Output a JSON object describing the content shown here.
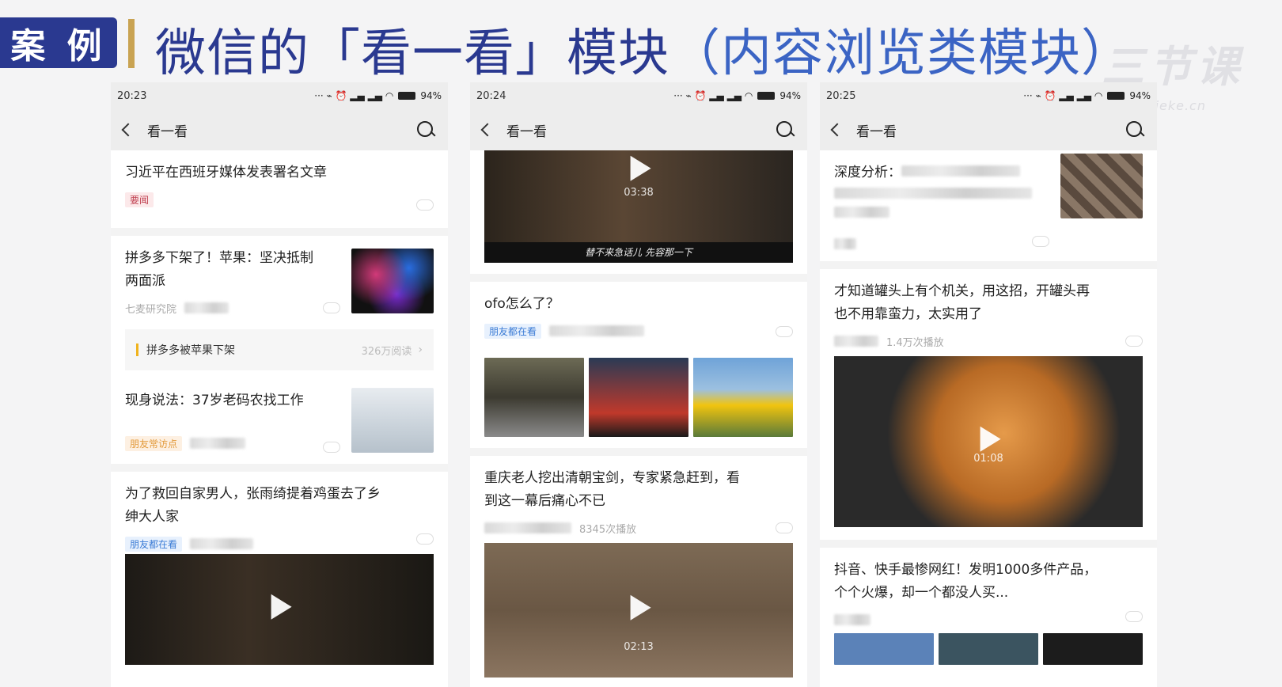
{
  "header": {
    "badge": "案 例",
    "title_main": "微信的「看一看」模块",
    "title_sub": "（内容浏览类模块）",
    "watermark": "三节课",
    "watermark_site": "sanjieke.cn"
  },
  "phones": [
    {
      "time": "20:23",
      "battery": "94%",
      "nav_title": "看一看",
      "items": [
        {
          "title": "习近平在西班牙媒体发表署名文章",
          "tag": "要闻"
        },
        {
          "title_line1": "拼多多下架了！苹果：坚决抵制",
          "title_line2": "两面派",
          "source": "七麦研究院",
          "related_title": "拼多多被苹果下架",
          "related_count": "326万阅读"
        },
        {
          "title": "现身说法：37岁老码农找工作",
          "tag": "朋友常访点"
        },
        {
          "title_line1": "为了救回自家男人，张雨绮提着鸡蛋去了乡",
          "title_line2": "绅大人家",
          "tag": "朋友都在看"
        }
      ]
    },
    {
      "time": "20:24",
      "battery": "94%",
      "nav_title": "看一看",
      "video1": {
        "duration": "03:38",
        "caption": "替不来急话儿 先容那一下"
      },
      "items": [
        {
          "title": "ofo怎么了？",
          "tag": "朋友都在看"
        },
        {
          "title_line1": "重庆老人挖出清朝宝剑，专家紧急赶到，看",
          "title_line2": "到这一幕后痛心不已",
          "views": "8345次播放"
        }
      ],
      "video2": {
        "duration": "02:13"
      }
    },
    {
      "time": "20:25",
      "battery": "94%",
      "nav_title": "看一看",
      "items": [
        {
          "title": "深度分析："
        },
        {
          "title_line1": "才知道罐头上有个机关，用这招，开罐头再",
          "title_line2": "也不用靠蛮力，太实用了",
          "views": "1.4万次播放"
        },
        {
          "title_line1": "抖音、快手最惨网红！发明1000多件产品，",
          "title_line2": "个个火爆，却一个都没人买..."
        }
      ],
      "video": {
        "duration": "01:08"
      }
    }
  ]
}
